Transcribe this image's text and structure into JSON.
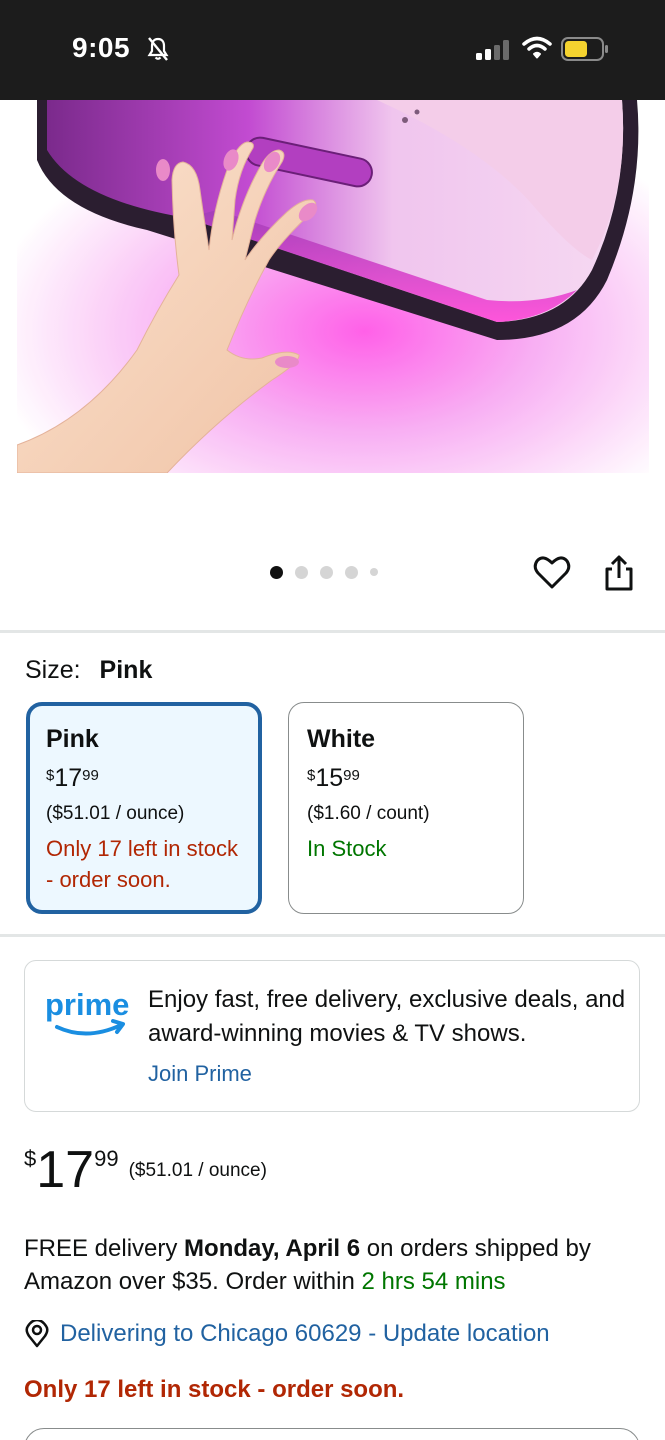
{
  "status_bar": {
    "time": "9:05"
  },
  "carousel": {
    "total": 5,
    "active": 0
  },
  "size": {
    "label": "Size:",
    "value": "Pink"
  },
  "variants": [
    {
      "name": "Pink",
      "currency": "$",
      "whole": "17",
      "fraction": "99",
      "unit_price": "($51.01 / ounce)",
      "stock": "Only 17 left in stock - order soon."
    },
    {
      "name": "White",
      "currency": "$",
      "whole": "15",
      "fraction": "99",
      "unit_price": "($1.60 / count)",
      "stock": "In Stock"
    }
  ],
  "prime": {
    "logo_text": "prime",
    "text": "Enjoy fast, free delivery, exclusive deals, and award-winning movies & TV shows.",
    "link": "Join Prime"
  },
  "price": {
    "currency": "$",
    "whole": "17",
    "fraction": "99",
    "unit": "($51.01 / ounce)"
  },
  "delivery": {
    "prefix": "FREE delivery ",
    "date": "Monday, April 6",
    "middle": " on orders shipped by Amazon over $35. Order within ",
    "timer": "2 hrs 54 mins"
  },
  "location": {
    "text": "Delivering to Chicago 60629 - Update location"
  },
  "low_stock": "Only 17 left in stock - order soon.",
  "colors": {
    "link": "#2162a1",
    "alert": "#b12704",
    "success": "#007600",
    "selected_border": "#2162a1"
  }
}
